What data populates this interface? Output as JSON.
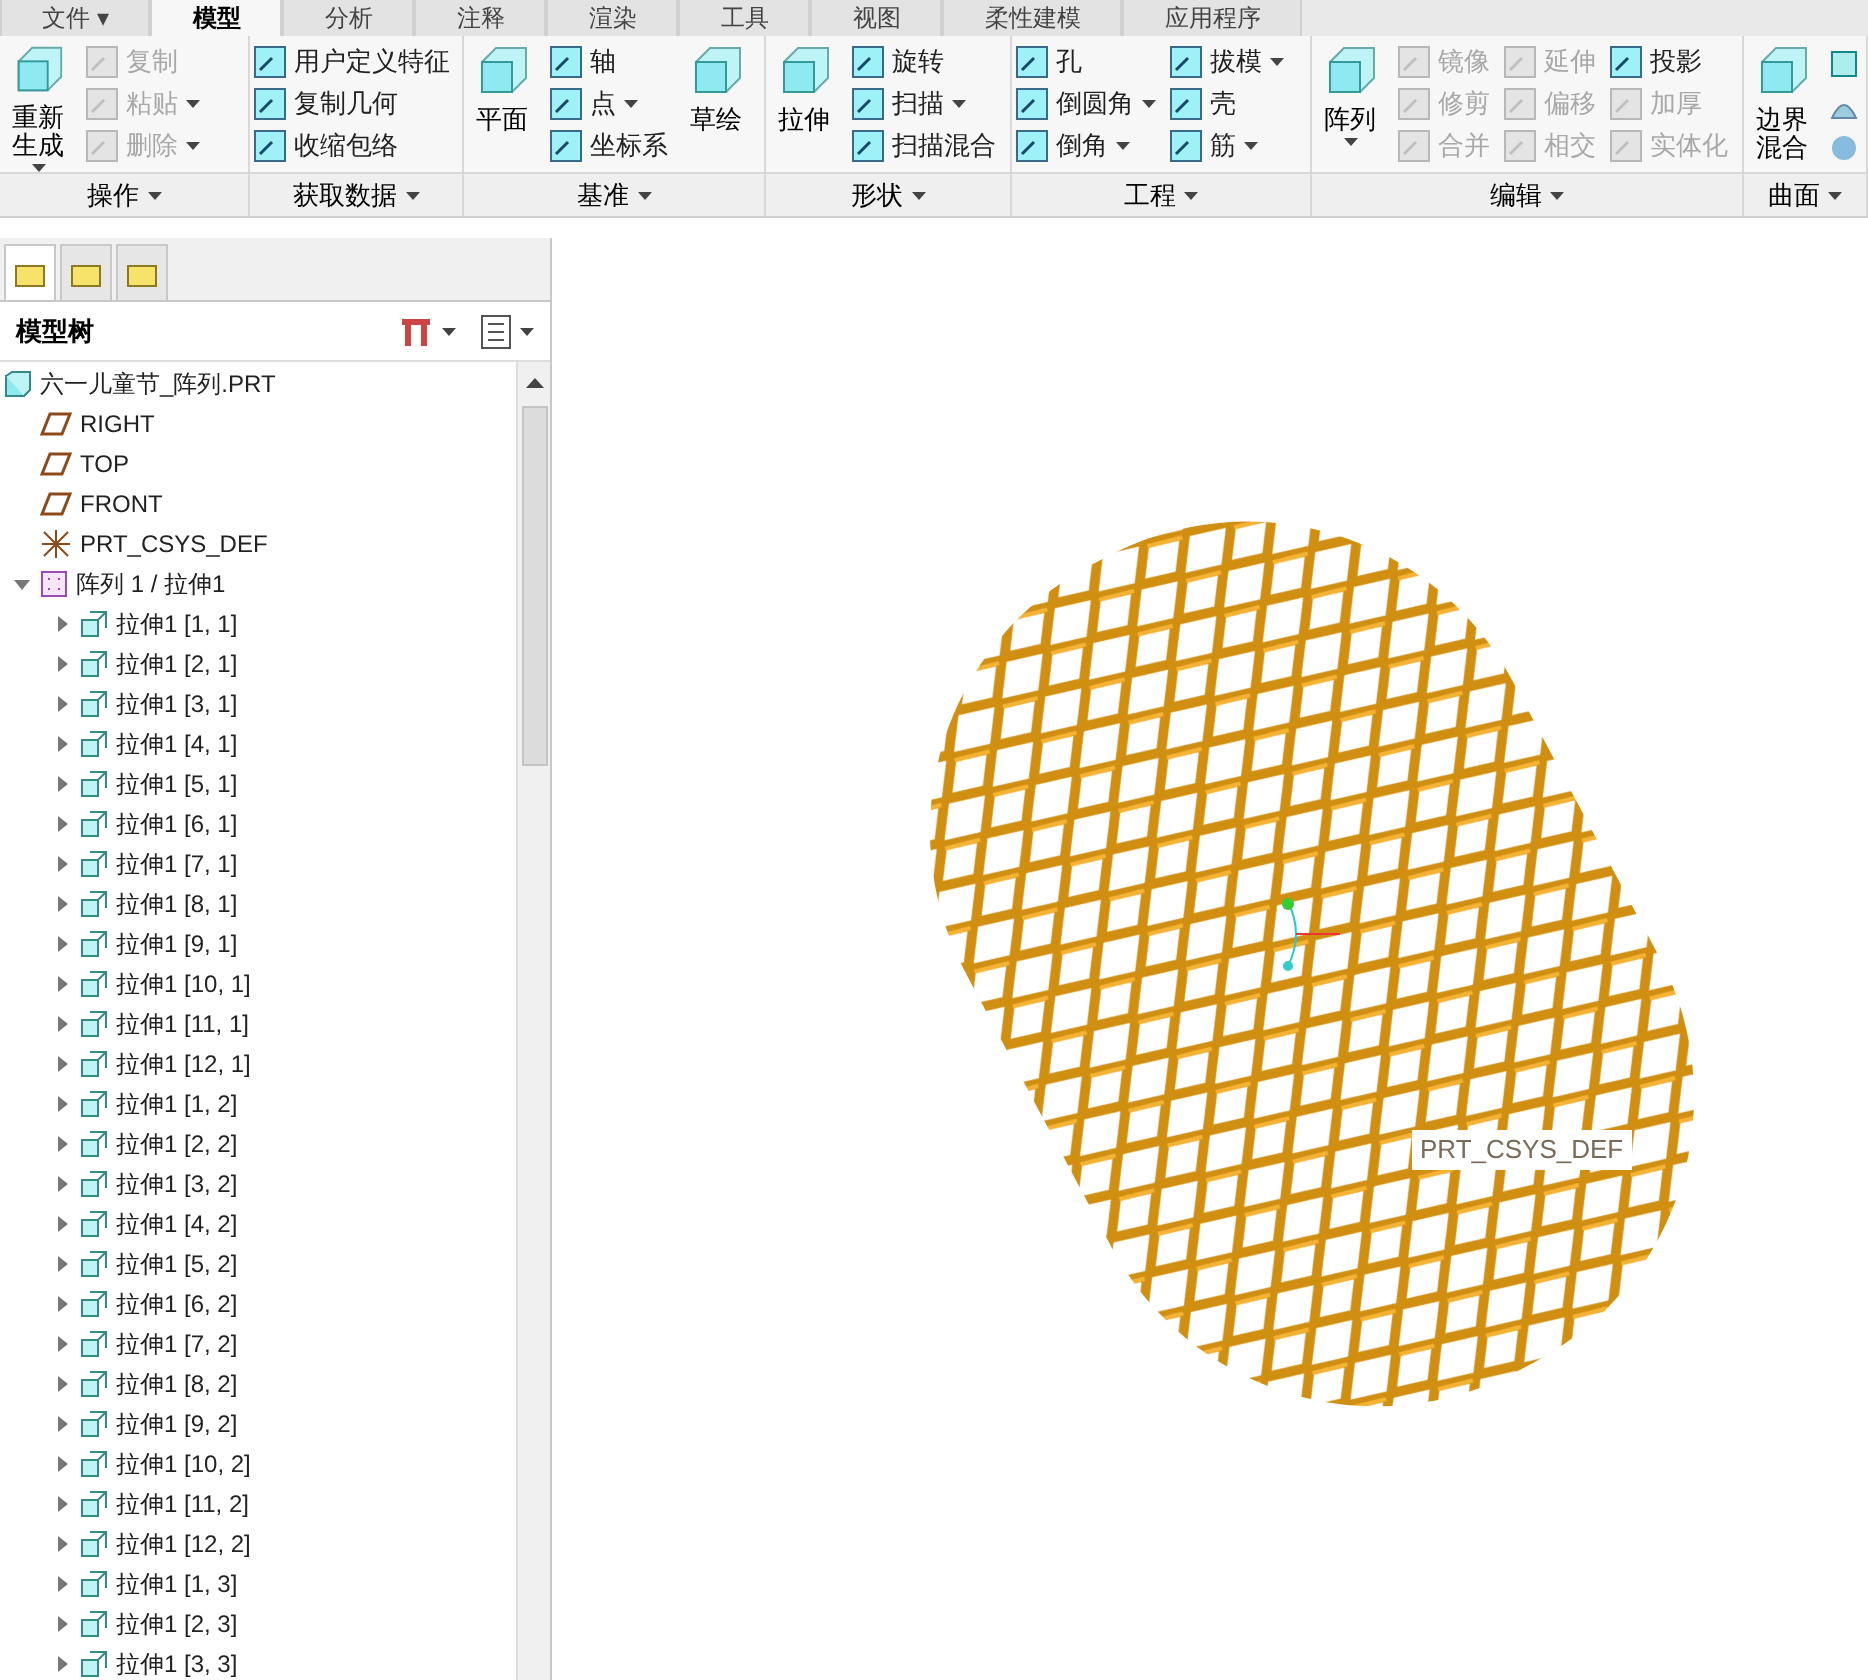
{
  "ribbon": {
    "tabs": [
      {
        "label": "文件 ▾",
        "selected": false
      },
      {
        "label": "模型",
        "selected": true
      },
      {
        "label": "分析",
        "selected": false
      },
      {
        "label": "注释",
        "selected": false
      },
      {
        "label": "渲染",
        "selected": false
      },
      {
        "label": "工具",
        "selected": false
      },
      {
        "label": "视图",
        "selected": false
      },
      {
        "label": "柔性建模",
        "selected": false
      },
      {
        "label": "应用程序",
        "selected": false
      }
    ],
    "groups": [
      {
        "label": "操作",
        "controls": [
          {
            "kind": "large",
            "label": "重新生成",
            "dropdown": true,
            "disabled": false
          },
          {
            "kind": "column",
            "items": [
              {
                "label": "复制",
                "dropdown": false,
                "disabled": true
              },
              {
                "label": "粘贴",
                "dropdown": true,
                "disabled": true
              },
              {
                "label": "删除",
                "dropdown": true,
                "disabled": true
              }
            ]
          }
        ]
      },
      {
        "label": "获取数据",
        "controls": [
          {
            "kind": "column",
            "items": [
              {
                "label": "用户定义特征",
                "dropdown": false,
                "disabled": false
              },
              {
                "label": "复制几何",
                "dropdown": false,
                "disabled": false
              },
              {
                "label": "收缩包络",
                "dropdown": false,
                "disabled": false
              }
            ]
          }
        ]
      },
      {
        "label": "基准",
        "controls": [
          {
            "kind": "large",
            "label": "平面",
            "dropdown": false,
            "disabled": false
          },
          {
            "kind": "column",
            "items": [
              {
                "label": "轴",
                "dropdown": false,
                "disabled": false
              },
              {
                "label": "点",
                "dropdown": true,
                "disabled": false
              },
              {
                "label": "坐标系",
                "dropdown": false,
                "disabled": false
              }
            ]
          },
          {
            "kind": "large",
            "label": "草绘",
            "dropdown": false,
            "disabled": false
          }
        ]
      },
      {
        "label": "形状",
        "controls": [
          {
            "kind": "large",
            "label": "拉伸",
            "dropdown": false,
            "disabled": false
          },
          {
            "kind": "column",
            "items": [
              {
                "label": "旋转",
                "dropdown": false,
                "disabled": false
              },
              {
                "label": "扫描",
                "dropdown": true,
                "disabled": false
              },
              {
                "label": "扫描混合",
                "dropdown": false,
                "disabled": false
              }
            ]
          }
        ]
      },
      {
        "label": "工程",
        "controls": [
          {
            "kind": "column",
            "items": [
              {
                "label": "孔",
                "dropdown": false,
                "disabled": false
              },
              {
                "label": "倒圆角",
                "dropdown": true,
                "disabled": false
              },
              {
                "label": "倒角",
                "dropdown": true,
                "disabled": false
              }
            ]
          },
          {
            "kind": "column",
            "items": [
              {
                "label": "拔模",
                "dropdown": true,
                "disabled": false
              },
              {
                "label": "壳",
                "dropdown": false,
                "disabled": false
              },
              {
                "label": "筋",
                "dropdown": true,
                "disabled": false
              }
            ]
          }
        ]
      },
      {
        "label": "编辑",
        "controls": [
          {
            "kind": "large",
            "label": "阵列",
            "dropdown": true,
            "disabled": false
          },
          {
            "kind": "column",
            "items": [
              {
                "label": "镜像",
                "dropdown": false,
                "disabled": true
              },
              {
                "label": "修剪",
                "dropdown": false,
                "disabled": true
              },
              {
                "label": "合并",
                "dropdown": false,
                "disabled": true
              }
            ]
          },
          {
            "kind": "column",
            "items": [
              {
                "label": "延伸",
                "dropdown": false,
                "disabled": true
              },
              {
                "label": "偏移",
                "dropdown": false,
                "disabled": true
              },
              {
                "label": "相交",
                "dropdown": false,
                "disabled": true
              }
            ]
          },
          {
            "kind": "column",
            "items": [
              {
                "label": "投影",
                "dropdown": false,
                "disabled": false
              },
              {
                "label": "加厚",
                "dropdown": false,
                "disabled": true
              },
              {
                "label": "实体化",
                "dropdown": false,
                "disabled": true
              }
            ]
          }
        ]
      },
      {
        "label": "曲面",
        "controls": [
          {
            "kind": "large",
            "label": "边界混合",
            "dropdown": false,
            "disabled": false
          },
          {
            "kind": "icons"
          }
        ]
      }
    ]
  },
  "panel_tabs": [
    {
      "selected": true
    },
    {
      "selected": false
    },
    {
      "selected": false
    }
  ],
  "tree_title": "模型树",
  "tree": [
    {
      "label": "六一儿童节_阵列.PRT",
      "kind": "part",
      "children": [
        {
          "label": "RIGHT",
          "kind": "plane"
        },
        {
          "label": "TOP",
          "kind": "plane"
        },
        {
          "label": "FRONT",
          "kind": "plane"
        },
        {
          "label": "PRT_CSYS_DEF",
          "kind": "csys"
        },
        {
          "label": "阵列 1 / 拉伸1",
          "kind": "pattern",
          "expanded": true,
          "children": [
            {
              "label": "拉伸1 [1, 1]",
              "kind": "feature",
              "expanded": false
            },
            {
              "label": "拉伸1 [2, 1]",
              "kind": "feature",
              "expanded": false
            },
            {
              "label": "拉伸1 [3, 1]",
              "kind": "feature",
              "expanded": false
            },
            {
              "label": "拉伸1 [4, 1]",
              "kind": "feature",
              "expanded": false
            },
            {
              "label": "拉伸1 [5, 1]",
              "kind": "feature",
              "expanded": false
            },
            {
              "label": "拉伸1 [6, 1]",
              "kind": "feature",
              "expanded": false
            },
            {
              "label": "拉伸1 [7, 1]",
              "kind": "feature",
              "expanded": false
            },
            {
              "label": "拉伸1 [8, 1]",
              "kind": "feature",
              "expanded": false
            },
            {
              "label": "拉伸1 [9, 1]",
              "kind": "feature",
              "expanded": false
            },
            {
              "label": "拉伸1 [10, 1]",
              "kind": "feature",
              "expanded": false
            },
            {
              "label": "拉伸1 [11, 1]",
              "kind": "feature",
              "expanded": false
            },
            {
              "label": "拉伸1 [12, 1]",
              "kind": "feature",
              "expanded": false
            },
            {
              "label": "拉伸1 [1, 2]",
              "kind": "feature",
              "expanded": false
            },
            {
              "label": "拉伸1 [2, 2]",
              "kind": "feature",
              "expanded": false
            },
            {
              "label": "拉伸1 [3, 2]",
              "kind": "feature",
              "expanded": false
            },
            {
              "label": "拉伸1 [4, 2]",
              "kind": "feature",
              "expanded": false
            },
            {
              "label": "拉伸1 [5, 2]",
              "kind": "feature",
              "expanded": false
            },
            {
              "label": "拉伸1 [6, 2]",
              "kind": "feature",
              "expanded": false
            },
            {
              "label": "拉伸1 [7, 2]",
              "kind": "feature",
              "expanded": false
            },
            {
              "label": "拉伸1 [8, 2]",
              "kind": "feature",
              "expanded": false
            },
            {
              "label": "拉伸1 [9, 2]",
              "kind": "feature",
              "expanded": false
            },
            {
              "label": "拉伸1 [10, 2]",
              "kind": "feature",
              "expanded": false
            },
            {
              "label": "拉伸1 [11, 2]",
              "kind": "feature",
              "expanded": false
            },
            {
              "label": "拉伸1 [12, 2]",
              "kind": "feature",
              "expanded": false
            },
            {
              "label": "拉伸1 [1, 3]",
              "kind": "feature",
              "expanded": false
            },
            {
              "label": "拉伸1 [2, 3]",
              "kind": "feature",
              "expanded": false
            },
            {
              "label": "拉伸1 [3, 3]",
              "kind": "feature",
              "expanded": false
            }
          ]
        }
      ]
    }
  ],
  "viewport": {
    "csys_label": "PRT_CSYS_DEF"
  }
}
